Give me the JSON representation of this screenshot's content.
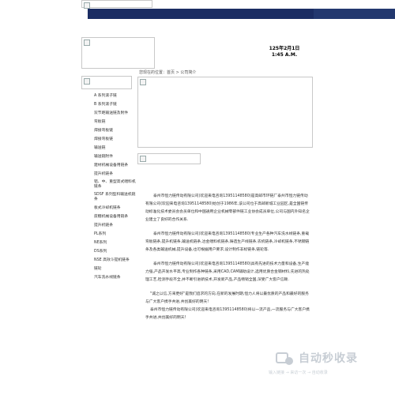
{
  "header": {
    "logo_alt": "",
    "date_line1": "125年2月1日",
    "date_line2": "1:45 A.M."
  },
  "breadcrumb": "您现在的位置：首页 > 公司简介",
  "sidebar": {
    "items": [
      "A 系列滚子链",
      "B 系列滚子链",
      "双节距输送链及附件",
      "弯板链",
      "焊接弯板链",
      "焊接弯板链",
      "输送链",
      "输送链附件",
      "建材机械设备用链条",
      "提升机链条",
      "铝、中、重型高式喂料机链条",
      "SDSF 系列型料输送机链条",
      "板式冷却机链条",
      "蔗糖机械设备用链条",
      "提升机链条",
      "PL系列",
      "NE系列",
      "DS系列",
      "NSE 高效斗提机链条",
      "链轮",
      "汽车洗水线链条"
    ]
  },
  "content": {
    "paragraphs": [
      "泰州市恒力链传动有限公司(欢迎来电咨询13951148580)是高邮市环链厂泰州市恒力链传动有限公司(欢迎来电咨询13951148580)始创于1986年,该公司位于高邮新城工业园区,是全国链传动标准化技术委员会会员单位和中国通用企业机械零部件链工业协会成员单位,公司与国内外知名企业建立了良好的合作关系.",
      "泰州市恒力链传动有限公司(欢迎来电咨询13951148580)专业生产各种汽车洗水线链条,重载弯板链条,提升机链条,输送机链条,冶金喂料机链条,铸造生产线链条,农机链条,冷却机链条,不锈钢链条及各类输送机械,提升设备,也可根据用户要求,设计制作非标链条,链轮等.",
      "泰州市恒力链传动有限公司(欢迎来电咨询13951148580)具有先进的技术力量和设备,生产能力强,产品开发水平高,专业制作各种链条,采用CAD,CAM辅助设计,选用优质合金钢材料,先进的热处理工艺,检测手段齐全,并不断引进新技术,开发新产品,产品畅销全国,深受广大客户信赖."
    ],
    "quote": "\"诚之以信,方来更好\"是我们追求的方向,在新的发展时期,恒力人将以最优质的产品和最好的服务与广大客户携手共进,共创美好的明天!",
    "quote2": "泰州市恒力链传动有限公司(欢迎来电咨询13951148580)将以一流产品,一流服务与广大客户携手共进,共创美好的明天!"
  },
  "watermark": {
    "title": "自动秒收录",
    "subtitle": "输入链接 → 来访一次 → 自动收录"
  }
}
